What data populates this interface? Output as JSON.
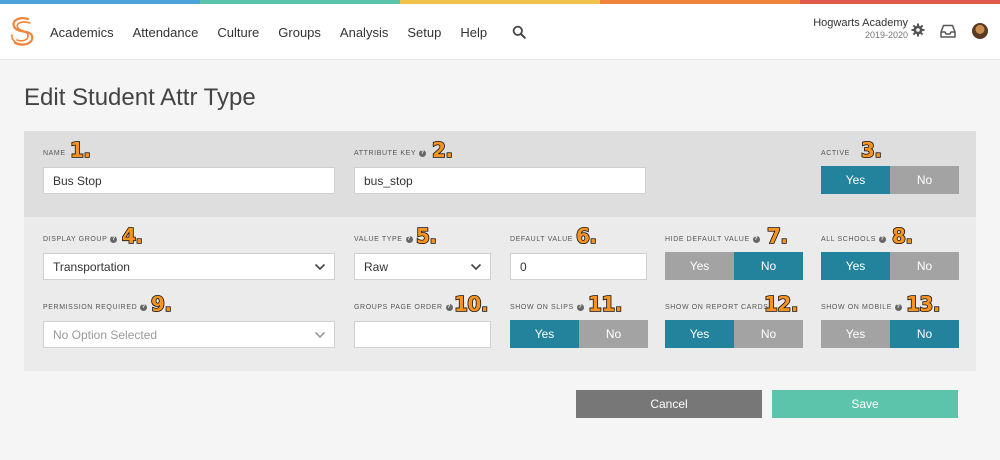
{
  "colors": {
    "stripe": [
      "#4aa4d9",
      "#5bc4aa",
      "#f1c24a",
      "#f0843a",
      "#e0584e"
    ],
    "toggle_on": "#23839d",
    "toggle_off": "#a3a3a3",
    "cancel": "#777777",
    "save": "#5bc4aa",
    "badge": "#f7931e"
  },
  "nav": {
    "items": [
      "Academics",
      "Attendance",
      "Culture",
      "Groups",
      "Analysis",
      "Setup",
      "Help"
    ],
    "school_name": "Hogwarts Academy",
    "school_year": "2019-2020",
    "icons": [
      "logo-icon",
      "search-icon",
      "gear-icon",
      "inbox-icon",
      "avatar"
    ]
  },
  "page": {
    "title": "Edit Student Attr Type"
  },
  "form": {
    "name": {
      "label": "NAME",
      "value": "Bus Stop",
      "badge": "1."
    },
    "attribute_key": {
      "label": "ATTRIBUTE KEY",
      "value": "bus_stop",
      "badge": "2."
    },
    "active": {
      "label": "ACTIVE",
      "yes": "Yes",
      "no": "No",
      "selected": "Yes",
      "badge": "3."
    },
    "display_group": {
      "label": "DISPLAY GROUP",
      "value": "Transportation",
      "badge": "4."
    },
    "value_type": {
      "label": "VALUE TYPE",
      "value": "Raw",
      "badge": "5."
    },
    "default_value": {
      "label": "DEFAULT VALUE",
      "value": "0",
      "badge": "6."
    },
    "hide_default_value": {
      "label": "HIDE DEFAULT VALUE",
      "yes": "Yes",
      "no": "No",
      "selected": "No",
      "badge": "7."
    },
    "all_schools": {
      "label": "ALL SCHOOLS",
      "yes": "Yes",
      "no": "No",
      "selected": "Yes",
      "badge": "8."
    },
    "permission_required": {
      "label": "PERMISSION REQUIRED",
      "placeholder": "No Option Selected",
      "badge": "9."
    },
    "groups_page_order": {
      "label": "GROUPS PAGE ORDER",
      "value": "",
      "badge": "10."
    },
    "show_on_slips": {
      "label": "SHOW ON SLIPS",
      "yes": "Yes",
      "no": "No",
      "selected": "Yes",
      "badge": "11."
    },
    "show_on_report_cards": {
      "label": "SHOW ON REPORT CARDS",
      "yes": "Yes",
      "no": "No",
      "selected": "Yes",
      "badge": "12."
    },
    "show_on_mobile": {
      "label": "SHOW ON MOBILE",
      "yes": "Yes",
      "no": "No",
      "selected": "No",
      "badge": "13."
    }
  },
  "actions": {
    "cancel": "Cancel",
    "save": "Save"
  }
}
